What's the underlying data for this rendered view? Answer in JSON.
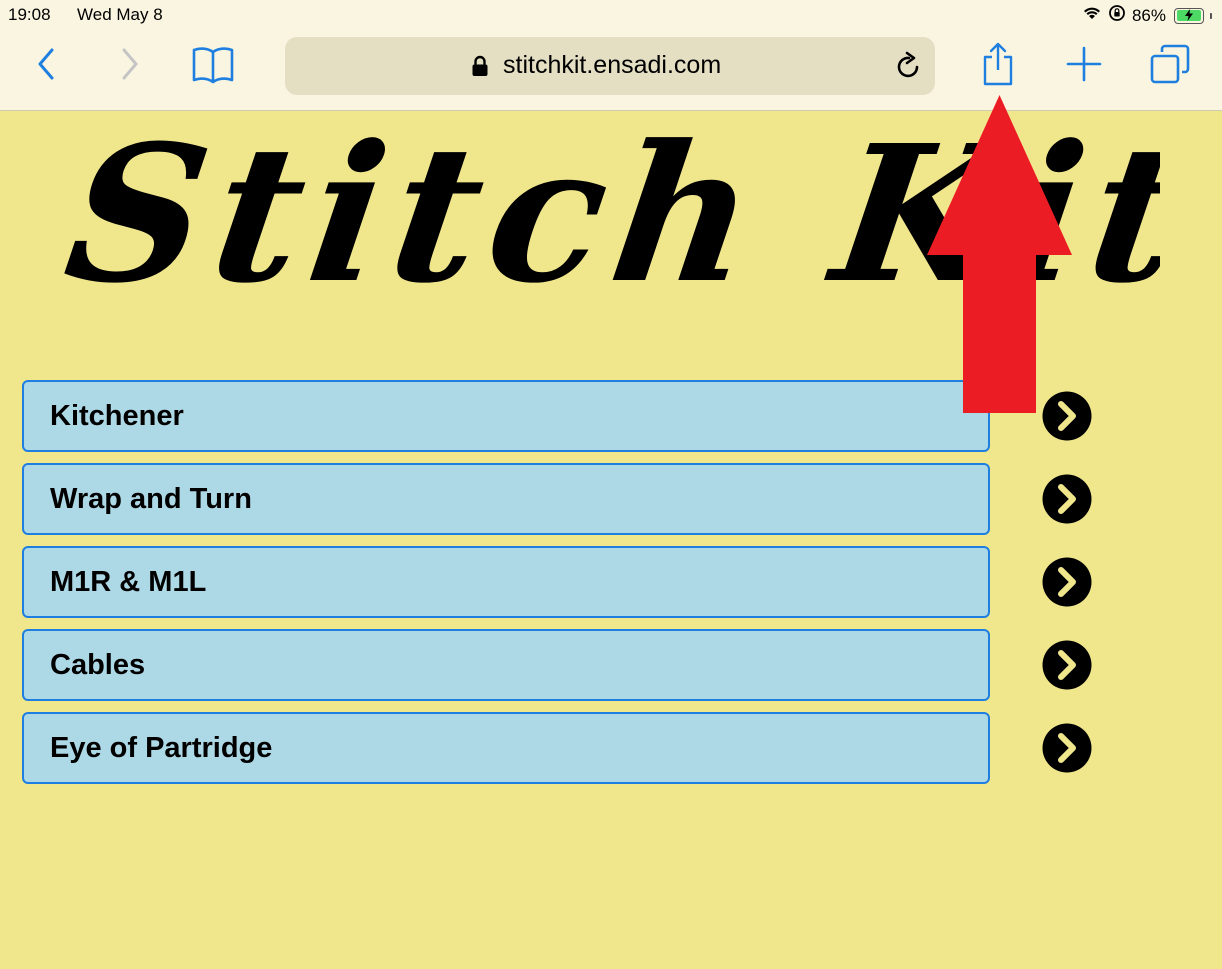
{
  "status_bar": {
    "time": "19:08",
    "date": "Wed May 8",
    "battery": "86%"
  },
  "browser": {
    "url": "stitchkit.ensadi.com",
    "accent_color": "#1e7fe0"
  },
  "page": {
    "logo_text": "Stitch Kit",
    "background_color": "#f0e68c",
    "items": [
      {
        "label": "Kitchener"
      },
      {
        "label": "Wrap and Turn"
      },
      {
        "label": "M1R & M1L"
      },
      {
        "label": "Cables"
      },
      {
        "label": "Eye of Partridge"
      }
    ]
  },
  "overlay": {
    "annotation": "red-up-arrow-icon",
    "color": "#ec1c24"
  }
}
